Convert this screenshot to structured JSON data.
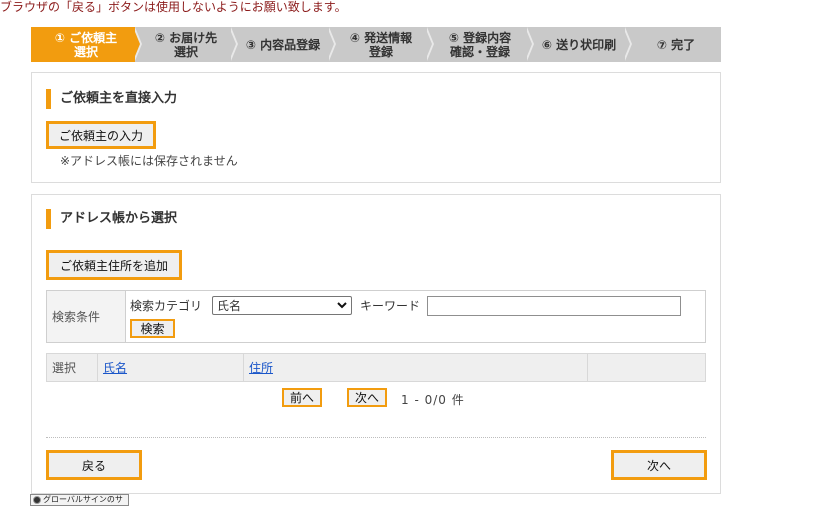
{
  "warning": "ブラウザの「戻る」ボタンは使用しないようにお願い致します。",
  "steps": [
    {
      "label": "① ご依頼主\n選択",
      "active": true
    },
    {
      "label": "② お届け先\n選択",
      "active": false
    },
    {
      "label": "③ 内容品登録",
      "active": false
    },
    {
      "label": "④ 発送情報\n登録",
      "active": false
    },
    {
      "label": "⑤ 登録内容\n確認・登録",
      "active": false
    },
    {
      "label": "⑥ 送り状印刷",
      "active": false
    },
    {
      "label": "⑦ 完了",
      "active": false
    }
  ],
  "direct": {
    "title": "ご依頼主を直接入力",
    "button": "ご依頼主の入力",
    "note": "※アドレス帳には保存されません"
  },
  "addressbook": {
    "title": "アドレス帳から選択",
    "add_button": "ご依頼主住所を追加",
    "search": {
      "condition_label": "検索条件",
      "category_label": "検索カテゴリ",
      "category_value": "氏名",
      "keyword_label": "キーワード",
      "keyword_value": "",
      "search_button": "検索"
    },
    "table": {
      "headers": [
        "選択",
        "氏名",
        "住所",
        ""
      ]
    },
    "pager": {
      "prev": "前へ",
      "next": "次へ",
      "count": "1 - 0/0 件"
    }
  },
  "nav": {
    "back": "戻る",
    "next": "次へ"
  },
  "badge": "グローバルサインのサ",
  "colors": {
    "accent": "#f29c0f",
    "step_inactive": "#c9c9c9",
    "warning_text": "#8b1a1a",
    "link": "#1a56c9"
  }
}
